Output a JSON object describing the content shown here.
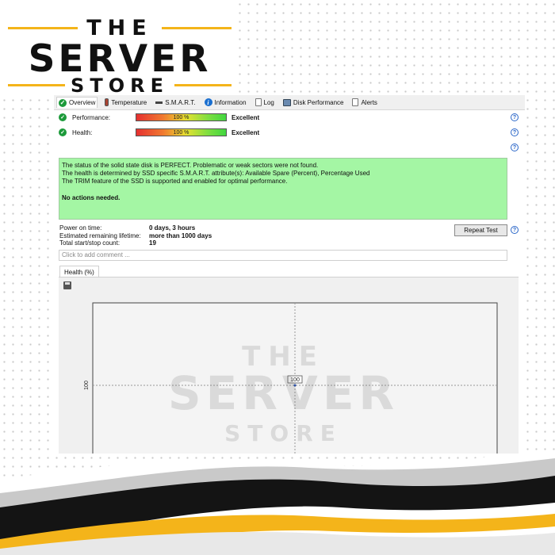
{
  "brand": {
    "line1": "THE",
    "line2": "SERVER",
    "line3": "STORE",
    "accent_color": "#f4b41a"
  },
  "tabs": [
    {
      "label": "Overview",
      "icon": "check-icon",
      "active": true
    },
    {
      "label": "Temperature",
      "icon": "thermometer-icon"
    },
    {
      "label": "S.M.A.R.T.",
      "icon": "smart-icon"
    },
    {
      "label": "Information",
      "icon": "info-icon"
    },
    {
      "label": "Log",
      "icon": "log-icon"
    },
    {
      "label": "Disk Performance",
      "icon": "disk-performance-icon"
    },
    {
      "label": "Alerts",
      "icon": "alerts-icon"
    }
  ],
  "performance": {
    "label": "Performance:",
    "value": "100 %",
    "percent": 100,
    "rating": "Excellent"
  },
  "health": {
    "label": "Health:",
    "value": "100 %",
    "percent": 100,
    "rating": "Excellent"
  },
  "status": {
    "line1": "The status of the solid state disk is PERFECT. Problematic or weak sectors were not found.",
    "line2": "The health is determined by SSD specific S.M.A.R.T. attribute(s):  Available Spare (Percent), Percentage Used",
    "line3": "The TRIM feature of the SSD is supported and enabled for optimal performance.",
    "action": "No actions needed.",
    "color": "#a4f6a4"
  },
  "info": {
    "power_on_label": "Power on time:",
    "power_on_value": "0 days, 3 hours",
    "lifetime_label": "Estimated remaining lifetime:",
    "lifetime_value": "more than 1000 days",
    "startstop_label": "Total start/stop count:",
    "startstop_value": "19"
  },
  "repeat_button": "Repeat Test",
  "comment_placeholder": "Click to add comment ...",
  "chart_tab": "Health (%)",
  "chart_data": {
    "type": "line",
    "series": [
      {
        "values": [
          100
        ]
      }
    ],
    "ytick_labels": [
      "100"
    ],
    "point_label": "100",
    "grid": true
  },
  "watermark": {
    "line1": "THE",
    "line2": "SERVER",
    "line3": "STORE"
  }
}
